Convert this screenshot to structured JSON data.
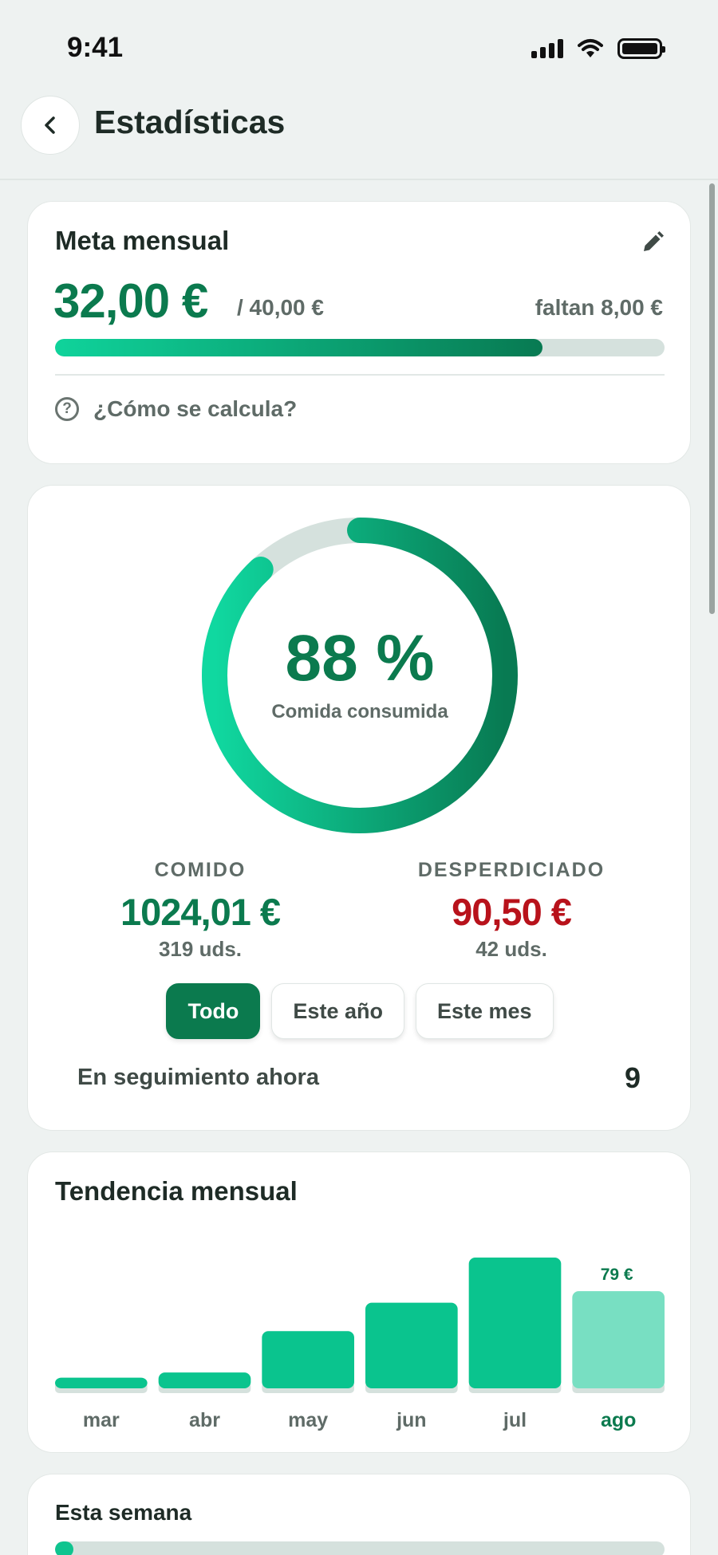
{
  "status": {
    "time": "9:41"
  },
  "header": {
    "title": "Estadísticas"
  },
  "goal": {
    "title": "Meta mensual",
    "amount": "32,00 €",
    "target": "/ 40,00 €",
    "remaining": "faltan 8,00 €",
    "progress": 0.8,
    "help_text": "¿Cómo se calcula?"
  },
  "summary": {
    "percent_value": "88 %",
    "percent_fraction": 0.88,
    "percent_label": "Comida consumida",
    "eaten": {
      "label": "COMIDO",
      "value": "1024,01 €",
      "units": "319 uds."
    },
    "wasted": {
      "label": "DESPERDICIADO",
      "value": "90,50 €",
      "units": "42 uds."
    },
    "filters": [
      "Todo",
      "Este año",
      "Este mes"
    ],
    "active_filter": "Todo",
    "tracking_label": "En seguimiento ahora",
    "tracking_value": "9",
    "colors": {
      "eaten": "#0b7a4e",
      "wasted": "#b8121b"
    }
  },
  "trend": {
    "title": "Tendencia mensual",
    "chart_data": {
      "type": "bar",
      "categories": [
        "mar",
        "abr",
        "may",
        "jun",
        "jul",
        "ago"
      ],
      "values": [
        12,
        16,
        48,
        70,
        105,
        79
      ],
      "highlight_index": 5,
      "highlight_label": "79 €",
      "ylim": [
        0,
        105
      ]
    }
  },
  "week": {
    "title": "Esta semana",
    "progress": 0.03
  }
}
